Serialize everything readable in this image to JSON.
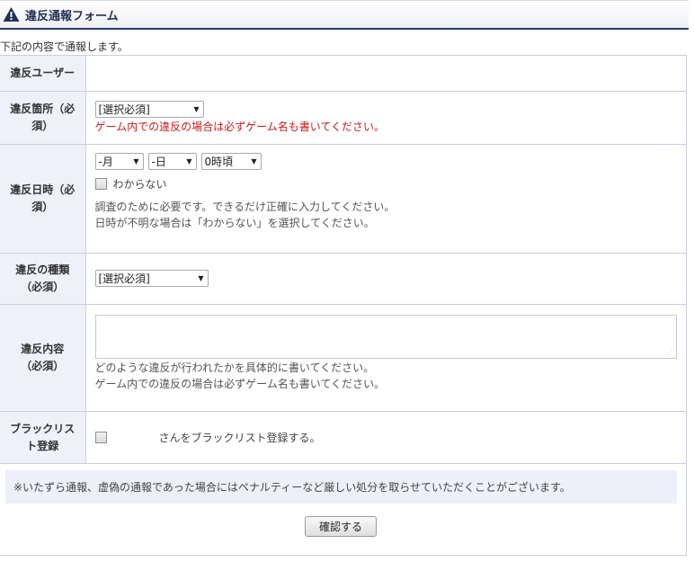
{
  "header": {
    "title": "違反通報フォーム",
    "icon": "warning-triangle-icon"
  },
  "intro": "下記の内容で通報します。",
  "fields": {
    "violator": {
      "label": "違反ユーザー",
      "value": ""
    },
    "location": {
      "label": "違反箇所（必須）",
      "select_value": "[選択必須]",
      "note": "ゲーム内での違反の場合は必ずゲーム名も書いてください。"
    },
    "datetime": {
      "label": "違反日時（必須）",
      "month": "-月",
      "day": "-日",
      "hour": "0時頃",
      "unknown_label": "わからない",
      "note1": "調査のために必要です。できるだけ正確に入力してください。",
      "note2": "日時が不明な場合は「わからない」を選択してください。"
    },
    "type": {
      "label": "違反の種類（必須）",
      "select_value": "[選択必須]"
    },
    "content": {
      "label": "違反内容（必須）",
      "value": "",
      "note1": "どのような違反が行われたかを具体的に書いてください。",
      "note2": "ゲーム内での違反の場合は必ずゲーム名も書いてください。"
    },
    "blacklist": {
      "label": "ブラックリスト登録",
      "text": "さんをブラックリスト登録する。"
    }
  },
  "warning": "※いたずら通報、虚偽の通報であった場合にはペナルティーなど厳しい処分を取らせていただくことがございます。",
  "confirm_label": "確認する",
  "colors": {
    "header_border": "#2a3f6b",
    "label_bg": "#eef1f8",
    "note_red": "#c81e1e",
    "warning_bg": "#edf0f9"
  }
}
